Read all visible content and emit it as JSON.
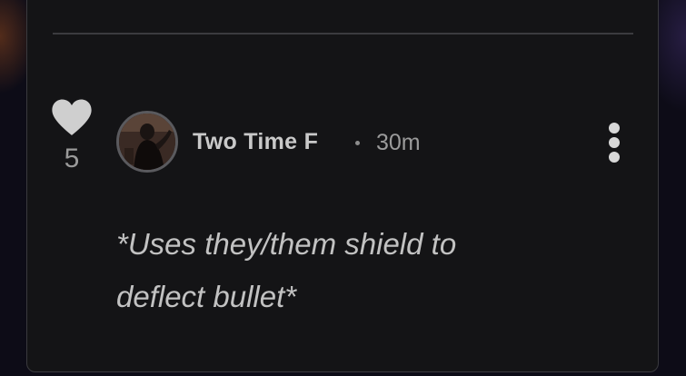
{
  "comment": {
    "author": "Two Time F",
    "separator": "•",
    "time_ago": "30m",
    "like_count": "5",
    "body_line1": "*Uses they/them shield to",
    "body_line2": "deflect bullet*"
  },
  "icons": {
    "like": "heart-icon",
    "more": "more-vertical-icon"
  },
  "colors": {
    "card_background": "#141416",
    "heart": "#cfcfcf",
    "text_primary": "#c9c9c9",
    "text_secondary": "#9b9b9b"
  }
}
